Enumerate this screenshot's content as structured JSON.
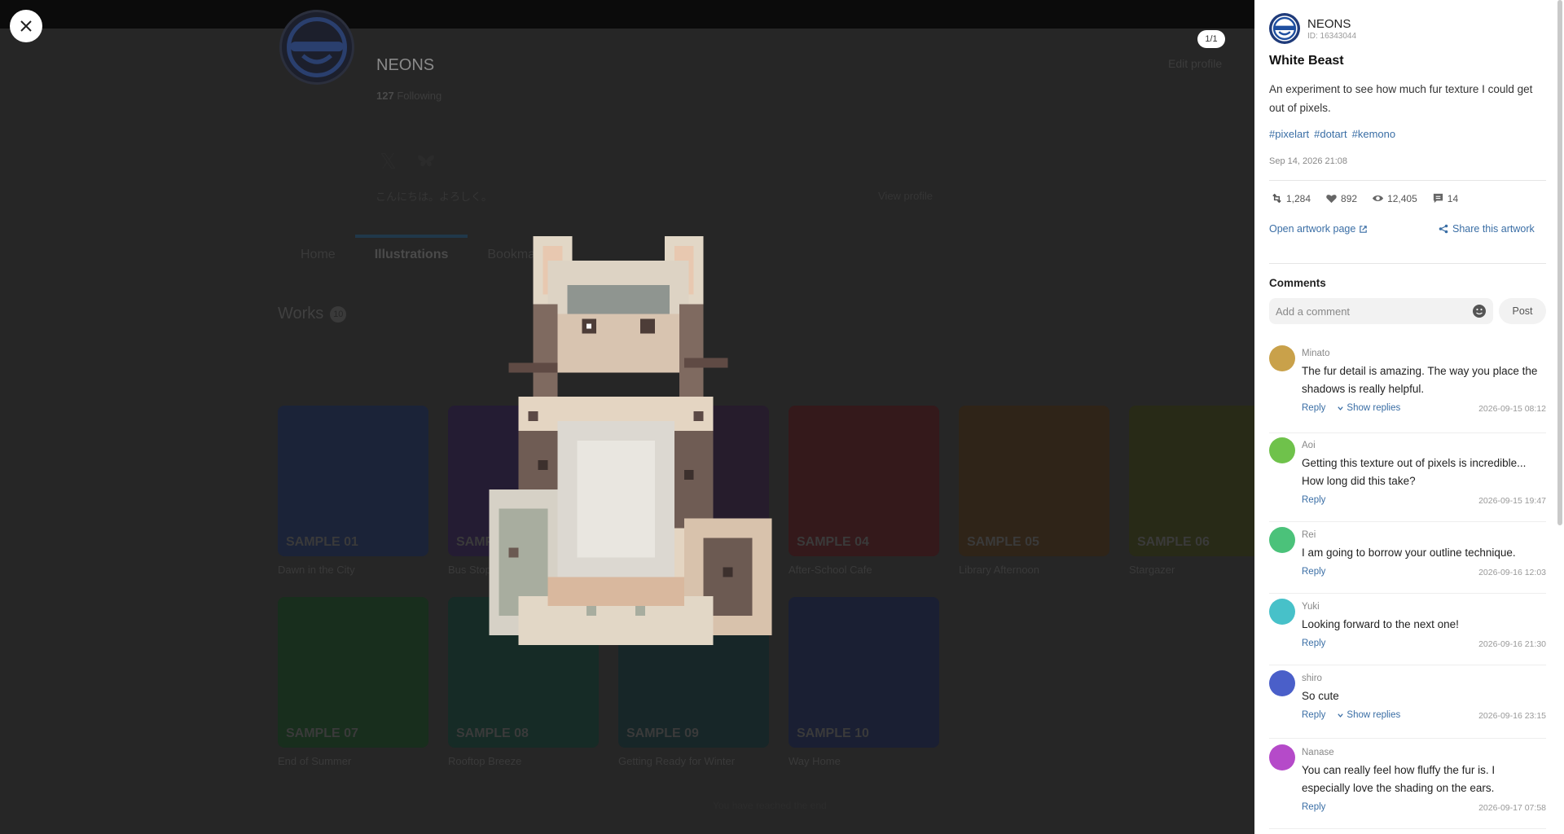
{
  "profile": {
    "name": "NEONS",
    "following_count": "127",
    "following_label": "Following",
    "edit_label": "Edit profile",
    "bio": "こんにちは。よろしく。",
    "view_profile": "View profile",
    "tabs": [
      "Home",
      "Illustrations",
      "Bookmarks"
    ],
    "works_label": "Works",
    "works_count": "10",
    "end_text": "You have reached the end",
    "works": [
      {
        "label": "SAMPLE 01",
        "title": "Dawn in the City",
        "color": "#1b2338"
      },
      {
        "label": "SAMPLE 02",
        "title": "Bus Stop Af...",
        "color": "#241c33"
      },
      {
        "label": "SAMPLE 03",
        "title": "",
        "color": "#261c2c"
      },
      {
        "label": "SAMPLE 04",
        "title": "After-School Cafe",
        "color": "#34191b"
      },
      {
        "label": "SAMPLE 05",
        "title": "Library Afternoon",
        "color": "#2f2418"
      },
      {
        "label": "SAMPLE 06",
        "title": "Stargazer",
        "color": "#282a17"
      },
      {
        "label": "SAMPLE 07",
        "title": "End of Summer",
        "color": "#182e1d"
      },
      {
        "label": "SAMPLE 08",
        "title": "Rooftop Breeze",
        "color": "#162b26"
      },
      {
        "label": "SAMPLE 09",
        "title": "Getting Ready for Winter",
        "color": "#172628"
      },
      {
        "label": "SAMPLE 10",
        "title": "Way Home",
        "color": "#1a1f33"
      }
    ]
  },
  "viewer": {
    "page_counter": "1/1"
  },
  "artwork": {
    "artist_name": "NEONS",
    "artist_id": "ID: 16343044",
    "title": "White Beast",
    "description": "An experiment to see how much fur texture I could get out of pixels.",
    "tags": [
      "#pixelart",
      "#dotart",
      "#kemono"
    ],
    "date": "Sep 14, 2026 21:08",
    "stats": {
      "retweets": "1,284",
      "likes": "892",
      "views": "12,405",
      "comments": "14"
    },
    "open_link": "Open artwork page",
    "share_link": "Share this artwork"
  },
  "comments": {
    "heading": "Comments",
    "placeholder": "Add a comment",
    "post_label": "Post",
    "reply_label": "Reply",
    "show_replies_label": "Show replies",
    "items": [
      {
        "name": "Minato",
        "text": "The fur detail is amazing. The way you place the shadows is really helpful.",
        "time": "2026-09-15 08:12",
        "has_replies": true,
        "color": "#c9a14a"
      },
      {
        "name": "Aoi",
        "text": "Getting this texture out of pixels is incredible... How long did this take?",
        "time": "2026-09-15 19:47",
        "has_replies": false,
        "color": "#6fc24b"
      },
      {
        "name": "Rei",
        "text": "I am going to borrow your outline technique.",
        "time": "2026-09-16 12:03",
        "has_replies": false,
        "color": "#4bc27a"
      },
      {
        "name": "Yuki",
        "text": "Looking forward to the next one!",
        "time": "2026-09-16 21:30",
        "has_replies": false,
        "color": "#47c1c9"
      },
      {
        "name": "shiro",
        "text": "So cute",
        "time": "2026-09-16 23:15",
        "has_replies": true,
        "color": "#4a5fc9"
      },
      {
        "name": "Nanase",
        "text": "You can really feel how fluffy the fur is. I especially love the shading on the ears.",
        "time": "2026-09-17 07:58",
        "has_replies": false,
        "color": "#b54ac9"
      }
    ]
  }
}
